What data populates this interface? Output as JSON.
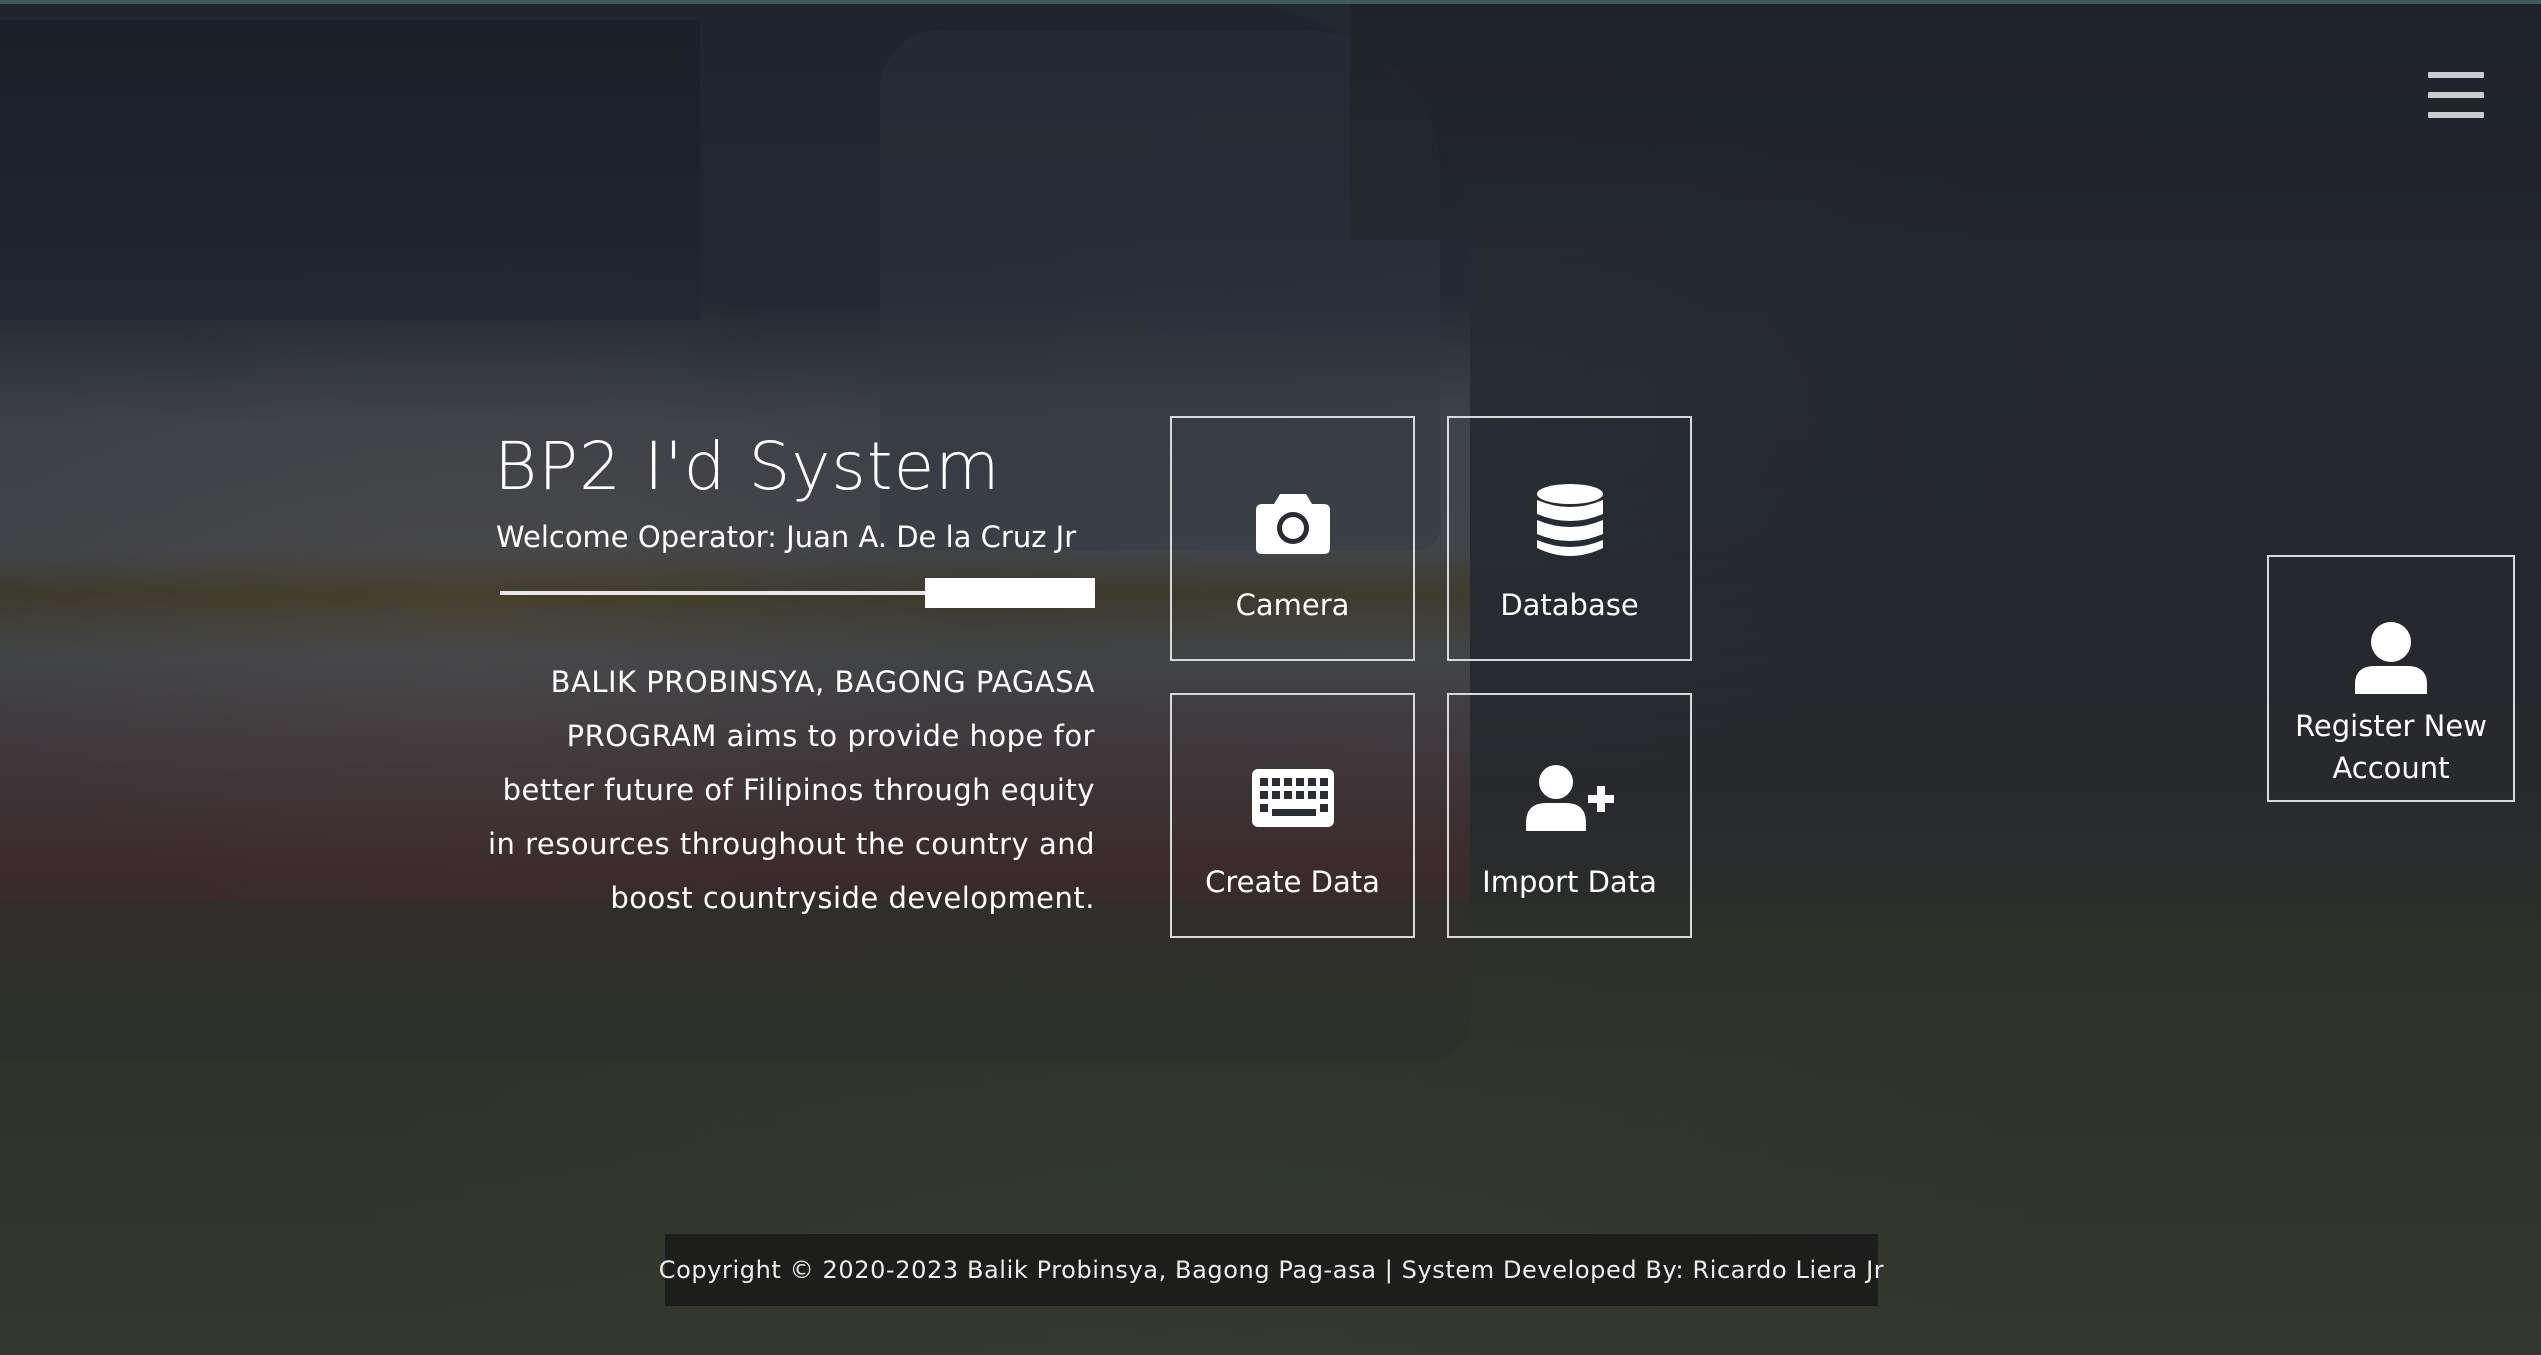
{
  "menu": {
    "icon": "hamburger-menu-icon"
  },
  "hero": {
    "title": "BP2 I'd System",
    "welcome": "Welcome Operator: Juan A. De la Cruz Jr",
    "description": "BALIK PROBINSYA, BAGONG PAGASA PROGRAM aims to provide hope for better future of Filipinos through equity in resources throughout the country and boost countryside development."
  },
  "tiles": [
    {
      "label": "Camera",
      "icon": "camera-icon"
    },
    {
      "label": "Database",
      "icon": "database-icon"
    },
    {
      "label": "Create Data",
      "icon": "keyboard-icon"
    },
    {
      "label": "Import Data",
      "icon": "user-plus-icon"
    }
  ],
  "register": {
    "label": "Register New Account",
    "icon": "user-icon"
  },
  "footer": {
    "text": "Copyright © 2020-2023 Balik Probinsya, Bagong Pag-asa | System Developed By: Ricardo Liera Jr"
  },
  "colors": {
    "overlay": "#14161e",
    "text": "#ffffff",
    "tile_border": "#d9d9d9",
    "footer_bg": "#191919"
  }
}
